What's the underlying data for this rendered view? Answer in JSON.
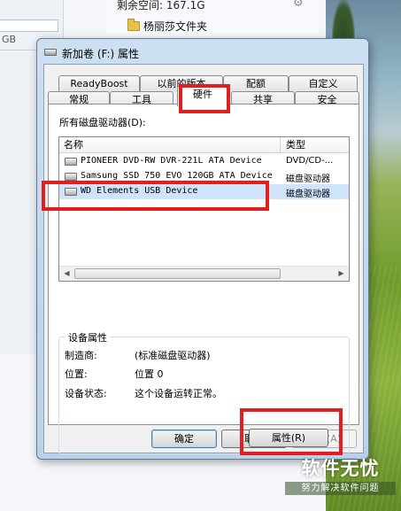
{
  "background": {
    "free_space_label": "剩余空间: 167.1G",
    "folder_name": "杨丽莎文件夹",
    "left_panel_text": "GB"
  },
  "dialog": {
    "title": "新加卷 (F:) 属性",
    "tabs_row1": [
      "ReadyBoost",
      "以前的版本",
      "配额",
      "自定义"
    ],
    "tabs_row2": [
      "常规",
      "工具",
      "硬件",
      "共享",
      "安全"
    ],
    "active_tab": "硬件",
    "drives_label": "所有磁盘驱动器(D):",
    "columns": [
      "名称",
      "类型"
    ],
    "drives": [
      {
        "name": "PIONEER DVD-RW  DVR-221L ATA Device",
        "type": "DVD/CD-..."
      },
      {
        "name": "Samsung SSD 750 EVO 120GB ATA Device",
        "type": "磁盘驱动器"
      },
      {
        "name": "WD Elements USB Device",
        "type": "磁盘驱动器"
      }
    ],
    "selected_drive_index": 2,
    "device_properties": {
      "title": "设备属性",
      "manufacturer_label": "制造商:",
      "manufacturer_value": "(标准磁盘驱动器)",
      "location_label": "位置:",
      "location_value": "位置 0",
      "status_label": "设备状态:",
      "status_value": "这个设备运转正常。"
    },
    "properties_button": "属性(R)",
    "ok_button": "确定",
    "cancel_button": "取消",
    "apply_button": "应用(A)"
  },
  "watermark": {
    "title": "软件无忧",
    "subtitle": "努力解决软件问题"
  },
  "colors": {
    "highlight_box": "#e02020",
    "selected_row": "#cfe3fb",
    "dialog_frame": "#b9d1ea"
  }
}
